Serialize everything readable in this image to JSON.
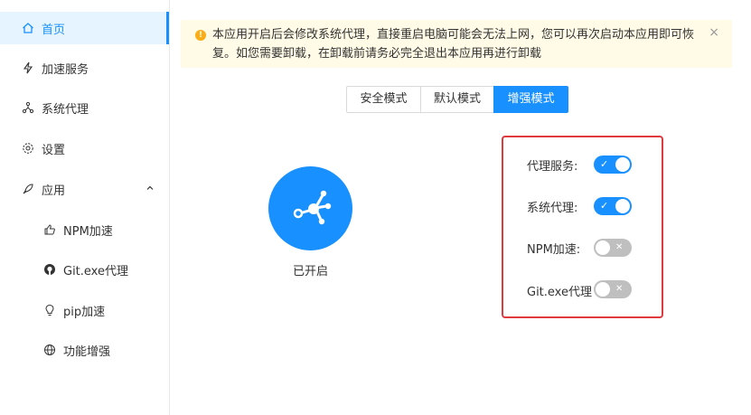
{
  "sidebar": {
    "items": [
      {
        "label": "首页",
        "icon": "home-icon",
        "active": true
      },
      {
        "label": "加速服务",
        "icon": "lightning-icon"
      },
      {
        "label": "系统代理",
        "icon": "network-icon"
      },
      {
        "label": "设置",
        "icon": "gear-icon"
      },
      {
        "label": "应用",
        "icon": "rocket-icon",
        "expanded": true
      }
    ],
    "subitems": [
      {
        "label": "NPM加速",
        "icon": "thumbs-up-icon"
      },
      {
        "label": "Git.exe代理",
        "icon": "github-icon"
      },
      {
        "label": "pip加速",
        "icon": "bulb-icon"
      },
      {
        "label": "功能增强",
        "icon": "globe-icon"
      }
    ]
  },
  "alert": {
    "text": "本应用开启后会修改系统代理，直接重启电脑可能会无法上网，您可以再次启动本应用即可恢复。如您需要卸载，在卸载前请务必完全退出本应用再进行卸载",
    "close": "×"
  },
  "modes": {
    "options": [
      "安全模式",
      "默认模式",
      "增强模式"
    ],
    "selected": "增强模式"
  },
  "status": {
    "label": "已开启"
  },
  "switches": [
    {
      "label": "代理服务:",
      "on": true,
      "mark": "✓"
    },
    {
      "label": "系统代理:",
      "on": true,
      "mark": "✓"
    },
    {
      "label": "NPM加速:",
      "on": false,
      "mark": "✕"
    },
    {
      "label": "Git.exe代理",
      "on": false,
      "mark": "✕"
    }
  ],
  "colors": {
    "primary": "#1890ff",
    "alert_bg": "#fffbe6",
    "warning": "#faad14",
    "highlight_border": "#e0393e",
    "switch_off": "#bfbfbf"
  }
}
